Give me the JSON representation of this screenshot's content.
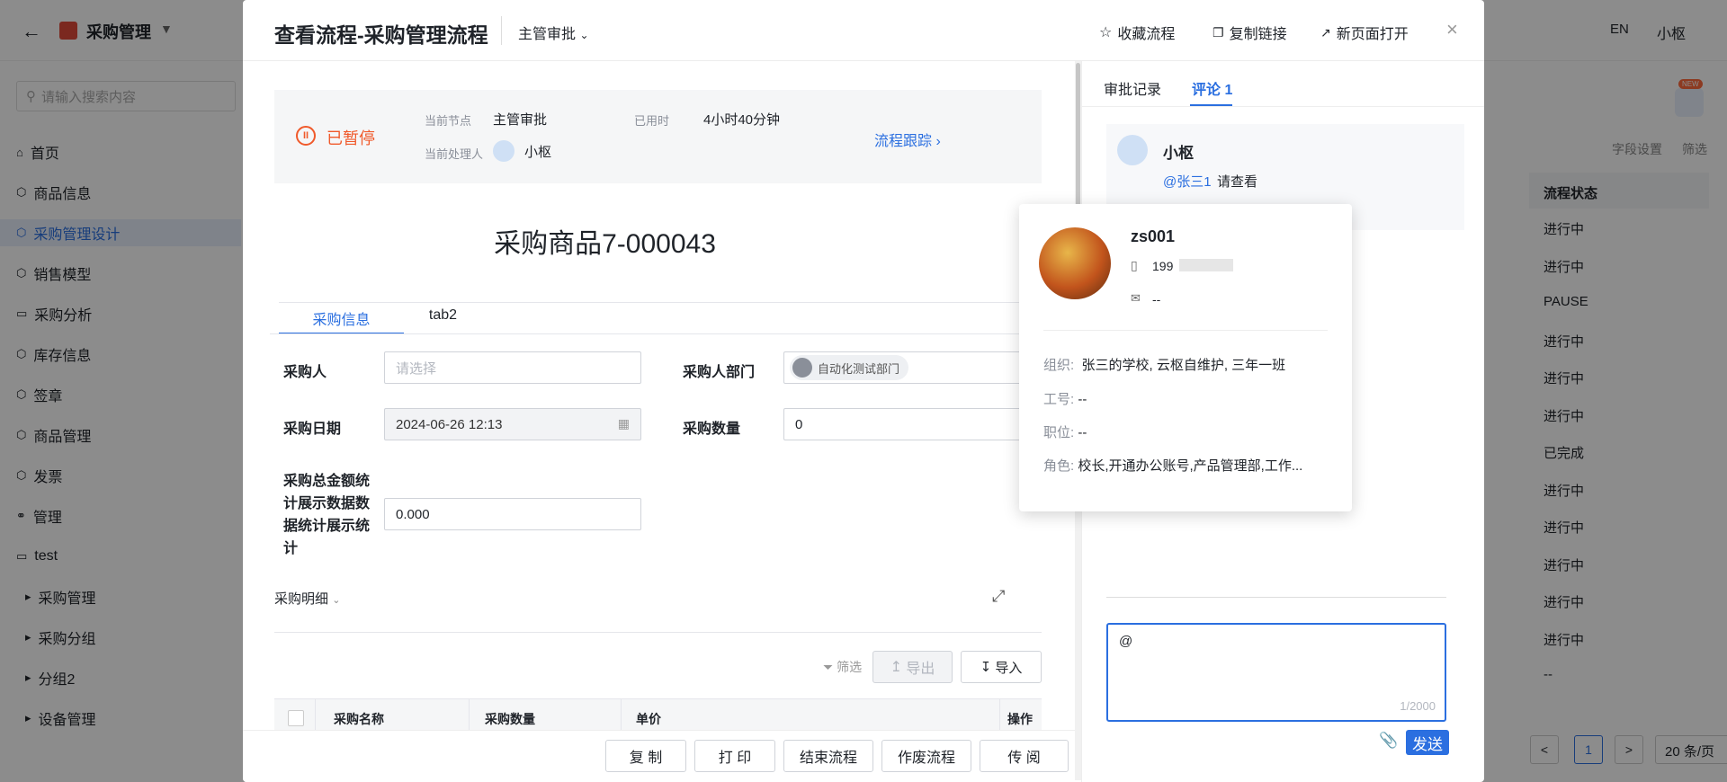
{
  "app": {
    "back_icon": "arrow-left-icon",
    "name": "采购管理",
    "search_placeholder": "请输入搜索内容",
    "topbar": {
      "lang": "EN",
      "user": "小枢"
    },
    "new_badge": "NEW",
    "sidebar": [
      {
        "label": "首页",
        "icon": "home-icon"
      },
      {
        "label": "商品信息",
        "icon": "cube-icon"
      },
      {
        "label": "采购管理设计",
        "icon": "cube-icon",
        "active": true
      },
      {
        "label": "销售模型",
        "icon": "cube-icon"
      },
      {
        "label": "采购分析",
        "icon": "monitor-icon"
      },
      {
        "label": "库存信息",
        "icon": "cube-icon"
      },
      {
        "label": "签章",
        "icon": "cube-icon"
      },
      {
        "label": "商品管理",
        "icon": "cube-icon"
      },
      {
        "label": "发票",
        "icon": "cube-icon"
      },
      {
        "label": "管理",
        "icon": "link-icon"
      },
      {
        "label": "test",
        "icon": "monitor-icon"
      },
      {
        "label": "采购管理",
        "icon": "caret-right-icon",
        "sub": true
      },
      {
        "label": "采购分组",
        "icon": "caret-right-icon",
        "sub": true
      },
      {
        "label": "分组2",
        "icon": "caret-right-icon",
        "sub": true
      },
      {
        "label": "设备管理",
        "icon": "caret-right-icon",
        "sub": true
      }
    ],
    "table": {
      "toolbar": [
        "字段设置",
        "筛选"
      ],
      "column": "流程状态",
      "rows": [
        "进行中",
        "进行中",
        "PAUSE",
        "进行中",
        "进行中",
        "进行中",
        "已完成",
        "进行中",
        "进行中",
        "进行中",
        "进行中",
        "进行中",
        "--"
      ],
      "pagination": {
        "page": "1",
        "page_size": "20 条/页"
      }
    }
  },
  "modal": {
    "title": "查看流程-采购管理流程",
    "node_dropdown": "主管审批",
    "actions": [
      "收藏流程",
      "复制链接",
      "新页面打开"
    ],
    "status": {
      "state": "已暂停",
      "current_node_label": "当前节点",
      "current_node": "主管审批",
      "elapsed_label": "已用时",
      "elapsed": "4小时40分钟",
      "handler_label": "当前处理人",
      "handler": "小枢",
      "trace_link": "流程跟踪"
    },
    "form_title": "采购商品7-000043",
    "tabs": [
      "采购信息",
      "tab2"
    ],
    "fields": {
      "buyer_label": "采购人",
      "buyer_placeholder": "请选择",
      "dept_label": "采购人部门",
      "dept_value": "自动化测试部门",
      "date_label": "采购日期",
      "date_value": "2024-06-26 12:13",
      "qty_label": "采购数量",
      "qty_value": "0",
      "total_label": "采购总金额统计展示数据数据统计展示统计",
      "total_value": "0.000"
    },
    "detail": {
      "title": "采购明细",
      "filter": "筛选",
      "export": "导出",
      "import": "导入",
      "columns": [
        "采购名称",
        "采购数量",
        "单价",
        "操作"
      ]
    },
    "footer_buttons": [
      "复 制",
      "打 印",
      "结束流程",
      "作废流程",
      "传 阅"
    ],
    "right": {
      "tabs": [
        "审批记录",
        "评论 1"
      ],
      "comment": {
        "author": "小枢",
        "mention": "@张三1",
        "text": "请查看"
      },
      "input_value": "@",
      "counter": "1/2000",
      "send": "发送"
    },
    "user_card": {
      "name": "zs001",
      "phone": "199",
      "email": "--",
      "org_label": "组织:",
      "org": "张三的学校, 云枢自维护, 三年一班",
      "jobno_label": "工号:",
      "jobno": "--",
      "position_label": "职位:",
      "position": "--",
      "role_label": "角色:",
      "role": "校长,开通办公账号,产品管理部,工作..."
    }
  }
}
